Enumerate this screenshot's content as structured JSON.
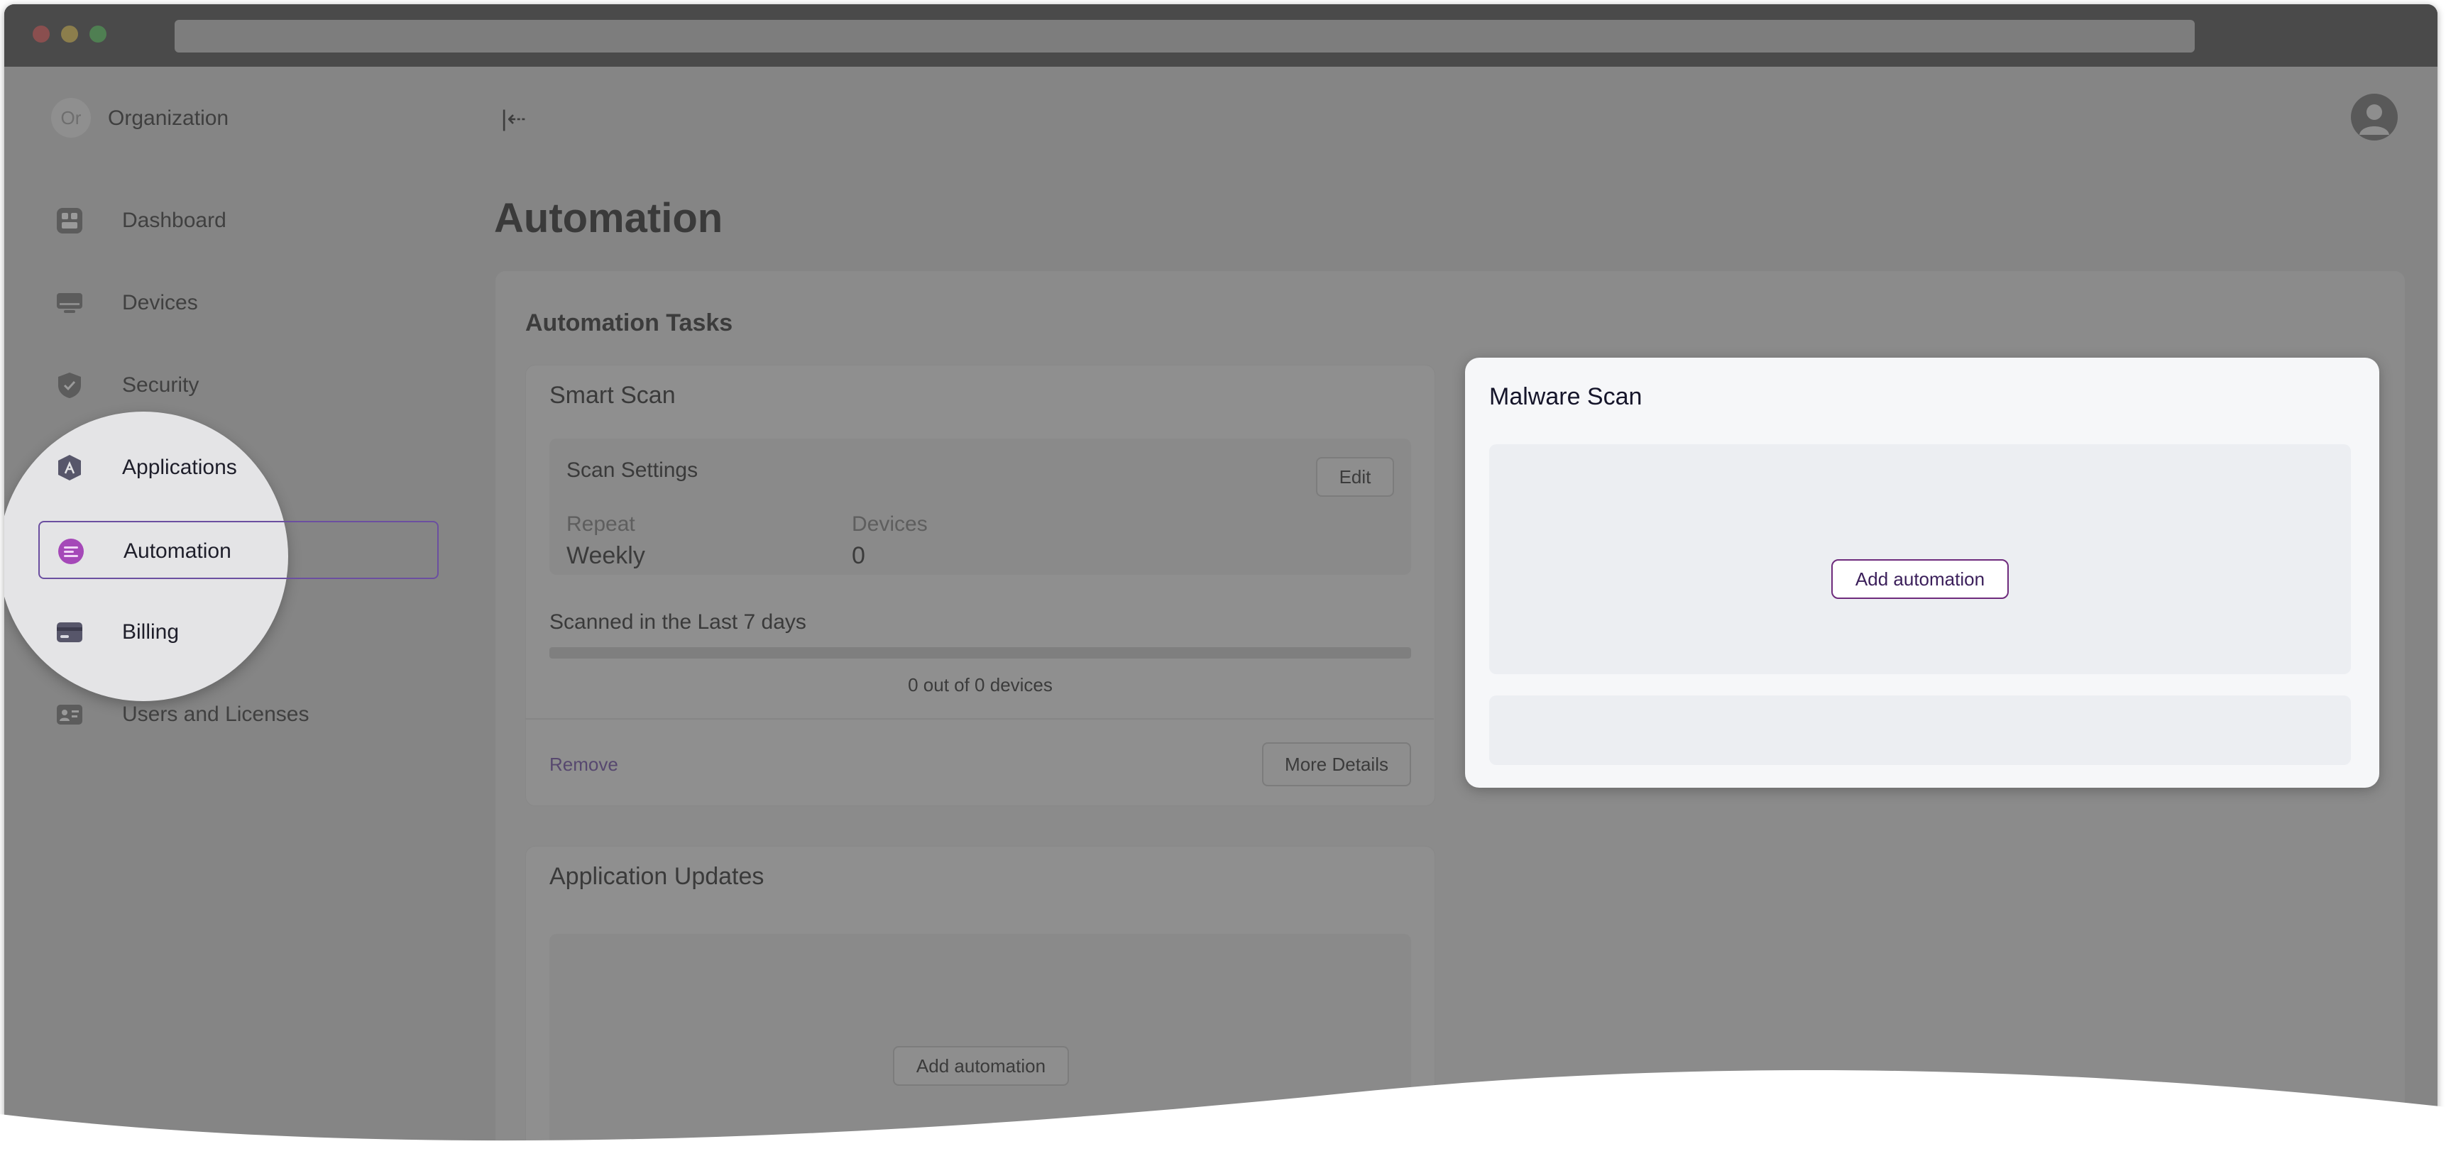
{
  "organization": {
    "initials": "Or",
    "name": "Organization"
  },
  "sidebar": {
    "items": [
      {
        "label": "Dashboard",
        "icon": "dashboard-icon"
      },
      {
        "label": "Devices",
        "icon": "devices-icon"
      },
      {
        "label": "Security",
        "icon": "shield-icon"
      },
      {
        "label": "Applications",
        "icon": "applications-icon"
      },
      {
        "label": "Automation",
        "icon": "automation-icon"
      },
      {
        "label": "Billing",
        "icon": "billing-icon"
      },
      {
        "label": "Users and Licenses",
        "icon": "users-icon"
      }
    ],
    "active_index": 4
  },
  "header": {
    "collapse_icon": "collapse-sidebar-icon",
    "avatar_icon": "user-avatar-icon"
  },
  "page": {
    "title": "Automation"
  },
  "automation_tasks": {
    "title": "Automation Tasks",
    "smart_scan": {
      "title": "Smart Scan",
      "settings_title": "Scan Settings",
      "edit_label": "Edit",
      "repeat_label": "Repeat",
      "repeat_value": "Weekly",
      "devices_label": "Devices",
      "devices_value": "0",
      "scanned_label": "Scanned in the Last 7 days",
      "scanned_progress": 0,
      "scanned_count": "0 out of 0 devices",
      "remove_label": "Remove",
      "more_details_label": "More Details"
    },
    "application_updates": {
      "title": "Application Updates",
      "add_label": "Add automation"
    },
    "malware_scan": {
      "title": "Malware Scan",
      "add_label": "Add automation"
    }
  },
  "colors": {
    "accent": "#6b4fa0",
    "highlight_button_border": "#6e2b7c",
    "overlay": "#858585"
  }
}
